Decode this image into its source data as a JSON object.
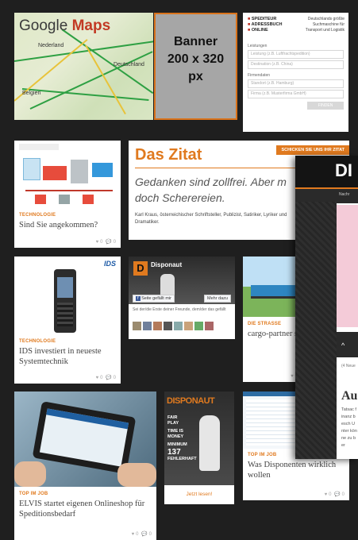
{
  "map": {
    "title_google": "Google",
    "title_maps": "Maps",
    "city1": "Deutschland",
    "city2": "Belgien",
    "city3": "Nederland"
  },
  "banner": {
    "line1": "Banner",
    "line2": "200 x 320",
    "line3": "px"
  },
  "spediteur": {
    "logo_lines": [
      "SPEDITEUR",
      "ADRESSBUCH",
      "ONLINE"
    ],
    "tagline_lines": [
      "Deutschlands größte",
      "Suchmaschine für",
      "Transport und Logistik"
    ],
    "section1": "Leistungen",
    "field1": "Leistung (z.B. Luftfrachtspedition)",
    "field2": "Destination (z.B. China)",
    "section2": "Firmendaten",
    "field3": "Standort (z.B. Hamburg)",
    "field4": "Firma (z.B. Musterfirma GmbH)",
    "button": "FINDEN"
  },
  "tiles": [
    {
      "category": "Technologie",
      "headline": "Sind Sie angekommen?",
      "likes": "0",
      "comments": "0"
    },
    {
      "category": "Technologie",
      "headline": "IDS investiert in neueste Systemtechnik",
      "likes": "0",
      "comments": "0"
    },
    {
      "category": "DIE STRASSE",
      "headline": "cargo-partner st Carrier Platform",
      "likes": "0",
      "comments": "0"
    },
    {
      "category": "TOP IM JOB",
      "headline": "ELVIS startet eigenen Onlineshop für Speditionsbedarf",
      "likes": "0",
      "comments": "0"
    },
    {
      "category": "TOP IM JOB",
      "headline": "Was Disponenten wirklich wollen",
      "likes": "0",
      "comments": "0"
    }
  ],
  "zitat": {
    "title": "Das Zitat",
    "button": "SCHICKEN SIE UNS IHR ZITAT",
    "quote": "Gedanken sind zollfrei. Aber m doch Scherereien.",
    "author": "Karl Kraus, österreichischer Schriftsteller, Publizist, Satiriker, Lyriker und Dramatiker."
  },
  "facebook": {
    "page_name": "Disponaut",
    "like_btn": "Seite gefällt mir",
    "more_btn": "Mehr dazu",
    "friends_text": "Sei der/die Erste deiner Freunde, dem/der das gefällt"
  },
  "magazine": {
    "title": "DISPONAUT",
    "cover_lines": [
      "FAIR",
      "PLAY",
      "TIME IS",
      "MONEY",
      "MINIMUM",
      "137",
      "FEHLERHAFT"
    ],
    "link": "Jetzt lesen!"
  },
  "overlay": {
    "logo": "DI",
    "nav": "Nachr",
    "article_cat": "(4 Neue",
    "article_title": "Au",
    "article_text": "Tatsac finanz besch Unter könne zu ber"
  },
  "ids_logo": "IDS",
  "colors": {
    "accent": "#e07a1f",
    "banner_bg": "#a6a6a6",
    "banner_border": "#d9731b"
  }
}
